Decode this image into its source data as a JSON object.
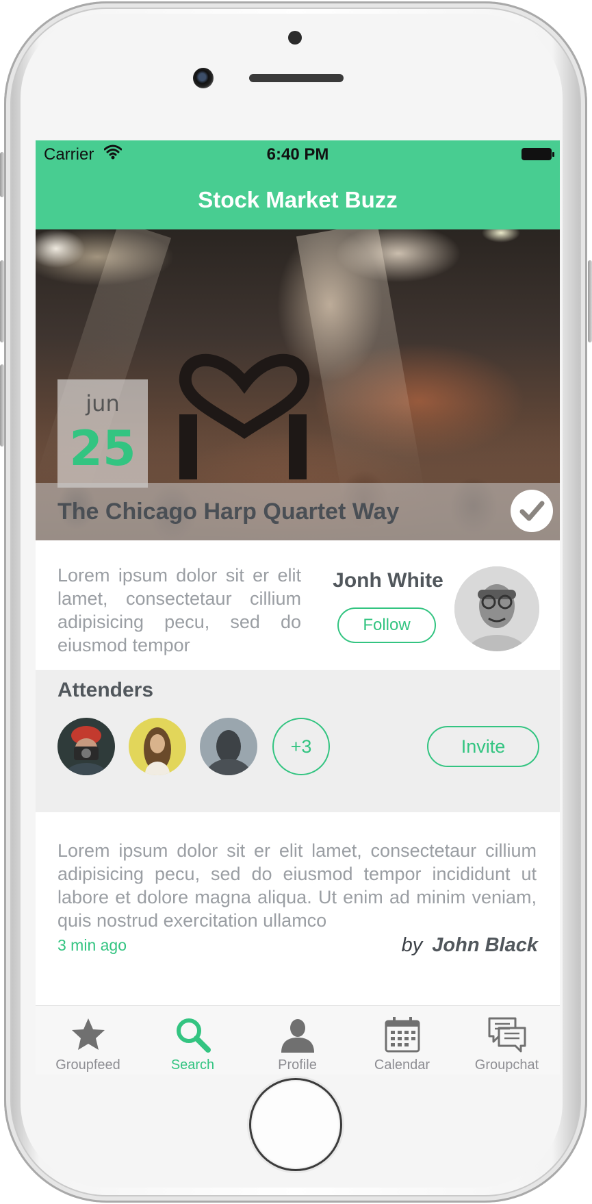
{
  "status_bar": {
    "carrier": "Carrier",
    "time": "6:40 PM"
  },
  "nav": {
    "title": "Stock Market Buzz"
  },
  "event": {
    "date_month": "jun",
    "date_day": "25",
    "title": "The Chicago Harp Quartet Way"
  },
  "host": {
    "blurb": "Lorem ipsum dolor sit er elit lamet, consectetaur cillium adipisicing pecu, sed do eiusmod tempor",
    "name": "Jonh White",
    "follow_label": "Follow"
  },
  "attenders": {
    "title": "Attenders",
    "more_label": "+3",
    "invite_label": "Invite"
  },
  "post": {
    "body": "Lorem ipsum dolor sit er elit lamet, consectetaur cillium adipisicing pecu, sed do eiusmod tempor incididunt ut labore et dolore magna aliqua. Ut enim ad minim veniam, quis nostrud exercitation ullamco",
    "time_ago": "3 min ago",
    "by_label": "by",
    "author": "John Black"
  },
  "tabs": [
    {
      "label": "Groupfeed",
      "icon": "star-icon"
    },
    {
      "label": "Search",
      "icon": "search-icon",
      "active": true
    },
    {
      "label": "Profile",
      "icon": "person-icon"
    },
    {
      "label": "Calendar",
      "icon": "calendar-icon"
    },
    {
      "label": "Groupchat",
      "icon": "chat-icon"
    }
  ],
  "colors": {
    "accent": "#48cd91",
    "accent_text": "#33c481",
    "inactive_tab": "#8e8e93"
  }
}
